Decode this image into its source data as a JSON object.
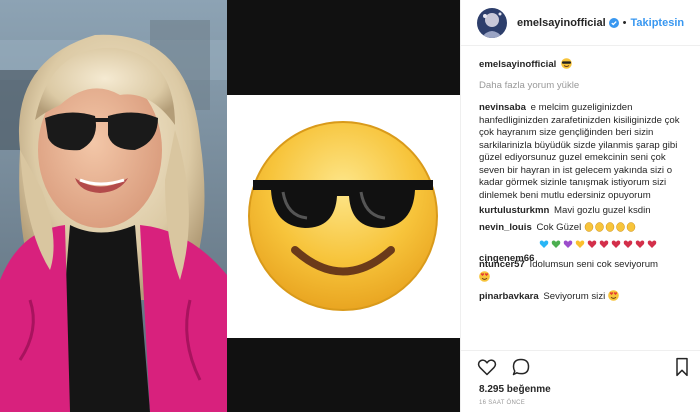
{
  "post": {
    "username": "emelsayinofficial",
    "follow_label": "Takiptesin",
    "separator": "•",
    "caption_user": "emelsayinofficial",
    "more_comments_label": "Daha fazla yorum yükle",
    "comments": [
      {
        "user": "nevinsaba",
        "text": "e melcim guzeliginizden hanfedliginizden zarafetinizden kisiliginizde çok çok hayranım size gençliğinden beri sizin sarkilarinizla büyüdük sizde yilanmis şarap gibi güzel ediyorsunuz guzel emekcinin seni çok seven bir hayran in ist gelecem yakında sizi o kadar görmek sizinle tanışmak istiyorum sizi dinlemek beni mutlu edersiniz opuyorum"
      },
      {
        "user": "kurtulusturkmn",
        "text": "Mavi gozlu guzel ksdin"
      },
      {
        "user": "nevin_louis",
        "text": "Cok Güzel"
      },
      {
        "user": "cingenem66",
        "text": ""
      },
      {
        "user": "ntuncer57",
        "text": "Idolumsun seni cok seviyorum"
      },
      {
        "user": "pinarbavkara",
        "text": "Seviyorum sizi"
      }
    ],
    "likes": "8.295 beğenme",
    "time": "16 SAAT ÖNCE"
  },
  "icons": {
    "verified": "verified-badge-icon",
    "like": "heart-icon",
    "comment": "comment-icon",
    "save": "bookmark-icon"
  },
  "colors": {
    "link_blue": "#3897f0",
    "meta_gray": "#999999",
    "text": "#262626",
    "border": "#efefef",
    "emoji_yellow": "#f7c43b",
    "jacket_pink": "#d8217d"
  }
}
